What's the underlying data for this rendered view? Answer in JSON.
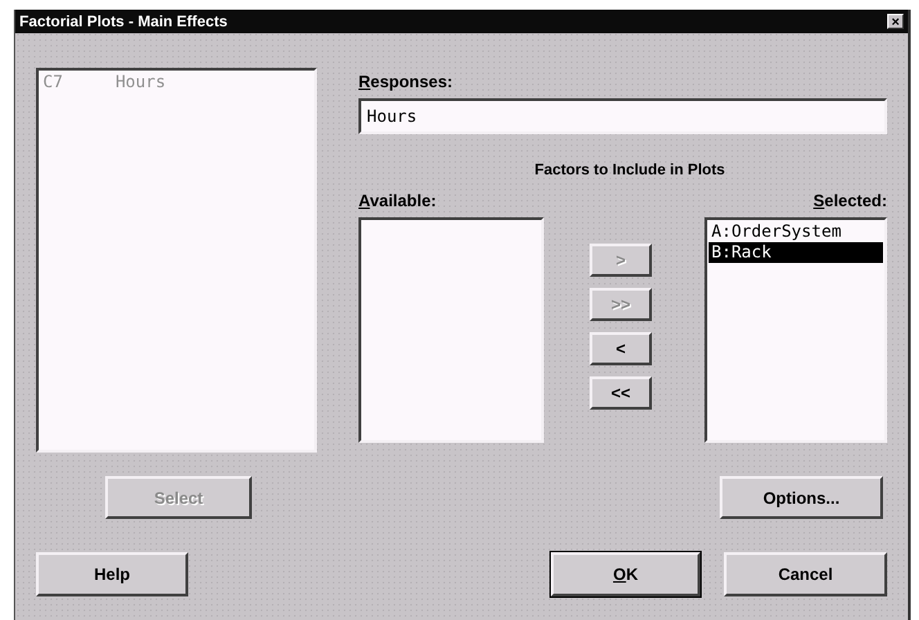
{
  "window": {
    "title": "Factorial Plots - Main Effects",
    "close": "×"
  },
  "columns_list": {
    "items": [
      {
        "column": "C7",
        "name": "Hours",
        "disabled": true
      }
    ]
  },
  "responses": {
    "label": "Responses:",
    "mnemonic": true,
    "value": "Hours"
  },
  "factors": {
    "title": "Factors to Include in Plots",
    "available": {
      "label": "Available:",
      "mnemonic": true
    },
    "move_buttons": [
      {
        "label": ">",
        "disabled": true
      },
      {
        "label": ">>",
        "disabled": true
      },
      {
        "label": "<",
        "disabled": false
      },
      {
        "label": "<<",
        "disabled": false
      }
    ],
    "selected_list": {
      "label": "Selected:",
      "mnemonic": true,
      "items": [
        {
          "text": "A:OrderSystem",
          "selected": false
        },
        {
          "text": "B:Rack",
          "selected": true
        }
      ]
    }
  },
  "select_button": {
    "label": "Select",
    "disabled": true
  },
  "buttons": [
    {
      "label": "Options...",
      "default": false,
      "disabled": false
    },
    {
      "label": "Help",
      "default": false,
      "disabled": false
    },
    {
      "label": "OK",
      "mnemonic": true,
      "default": true,
      "disabled": false
    },
    {
      "label": "Cancel",
      "default": false,
      "disabled": false
    }
  ]
}
